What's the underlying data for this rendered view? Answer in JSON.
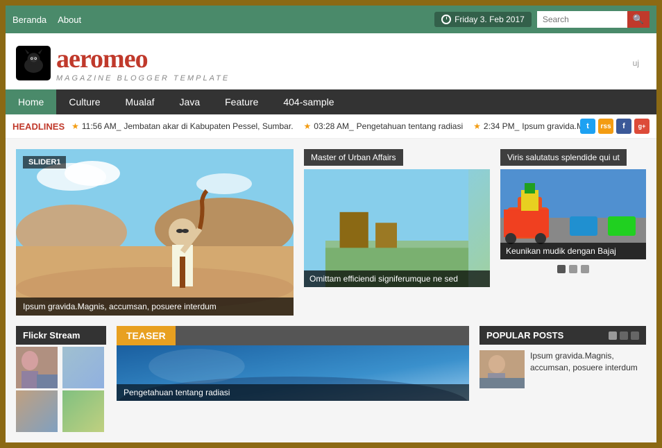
{
  "topbar": {
    "nav": [
      {
        "label": "Beranda",
        "active": true
      },
      {
        "label": "About",
        "active": false
      }
    ],
    "date": "Friday 3. Feb 2017",
    "search_placeholder": "Search"
  },
  "header": {
    "logo_title": "aeromeo",
    "logo_subtitle": "MAGAZINE BLOGGER TEMPLATE",
    "uj_label": "uj"
  },
  "mainnav": {
    "items": [
      {
        "label": "Home",
        "active": true
      },
      {
        "label": "Culture",
        "active": false
      },
      {
        "label": "Mualaf",
        "active": false
      },
      {
        "label": "Java",
        "active": false
      },
      {
        "label": "Feature",
        "active": false
      },
      {
        "label": "404-sample",
        "active": false
      }
    ]
  },
  "headlines": {
    "label": "HEADLINES",
    "items": [
      {
        "time": "11:56 AM_",
        "text": "Jembatan akar di Kabupaten Pessel, Sumbar."
      },
      {
        "time": "03:28 AM_",
        "text": "Pengetahuan tentang radiasi"
      },
      {
        "time": "2:34 PM_",
        "text": "Ipsum gravida.Mag"
      }
    ]
  },
  "slider": {
    "label": "SLIDER1",
    "caption": "Ipsum gravida.Magnis, accumsan, posuere interdum"
  },
  "middle_cards": [
    {
      "title": "Master of Urban Affairs",
      "caption": "Omittam efficiendi signiferumque ne sed"
    }
  ],
  "right_cards": [
    {
      "title": "Viris salutatus splendide qui ut",
      "caption": "Keunikan mudik dengan Bajaj"
    }
  ],
  "bottom": {
    "flickr_title": "Flickr Stream",
    "teaser_label": "TEASER",
    "teaser_caption": "Pengetahuan tentang radiasi",
    "popular_title": "POPULAR POSTS",
    "popular_item_text": "Ipsum gravida.Magnis, accumsan, posuere interdum"
  },
  "social": {
    "twitter": "t",
    "rss": "r",
    "facebook": "f",
    "gplus": "g+"
  }
}
